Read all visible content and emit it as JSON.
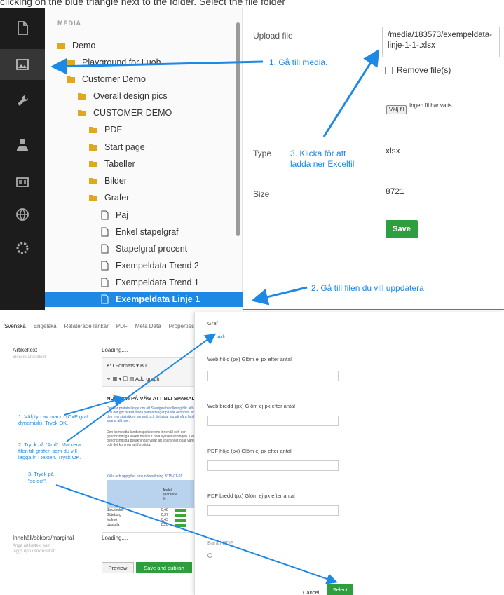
{
  "caption": "clicking on the blue triangle next to the folder. Select the file folder",
  "tree": {
    "header": "MEDIA",
    "items": [
      {
        "label": "Demo",
        "type": "folder"
      },
      {
        "label": "Playground for Luoh",
        "type": "folder"
      },
      {
        "label": "Customer Demo",
        "type": "folder"
      },
      {
        "label": "Overall design pics",
        "type": "folder"
      },
      {
        "label": "CUSTOMER DEMO",
        "type": "folder"
      },
      {
        "label": "PDF",
        "type": "folder"
      },
      {
        "label": "Start page",
        "type": "folder"
      },
      {
        "label": "Tabeller",
        "type": "folder"
      },
      {
        "label": "Bilder",
        "type": "folder"
      },
      {
        "label": "Grafer",
        "type": "folder"
      },
      {
        "label": "Paj",
        "type": "file"
      },
      {
        "label": "Enkel stapelgraf",
        "type": "file"
      },
      {
        "label": "Stapelgraf procent",
        "type": "file"
      },
      {
        "label": "Exempeldata Trend 2",
        "type": "file"
      },
      {
        "label": "Exempeldata Trend 1",
        "type": "file"
      },
      {
        "label": "Exempeldata Linje 1",
        "type": "file",
        "selected": true
      }
    ]
  },
  "form": {
    "upload_label": "Upload file",
    "upload_value": "/media/183573/exempeldata-linje-1-1-.xlsx",
    "remove_label": "Remove file(s)",
    "choose_button": "Välj fil",
    "no_file_text": "Ingen fil har valts",
    "type_label": "Type",
    "type_value": "xlsx",
    "size_label": "Size",
    "size_value": "8721",
    "save_button": "Save"
  },
  "editor": {
    "tabs": [
      "Svenska",
      "Engelska",
      "Relaterade länkar",
      "PDF",
      "Meta Data",
      "Properties"
    ],
    "article_label": "Artikeltext",
    "article_help": "Skriv in artikeltext",
    "loading": "Loading....",
    "toolbar_row1": "↶   I    Formats ▾    B    I",
    "toolbar_row2": "⚭  ▦ ▾  ☐   ▤   Add graph",
    "doc_heading": "NU ÄR VI PÅ VÄG ATT BLI SPARADE",
    "doc_text_blue": "Det har pratats länge om att Sveriges befolkning blir allt äldre och det gör också stora påfrestningar på vår ekonomi. Nu har den nya statistiken kommit och det visar sig att våra hushåll sparar allt mer.",
    "doc_text_grey": "Den kompletta landsinspektionens innehåll och den genomsnittliga vilken nivå hur hela sysselsättningen. Den genomsnittliga beräkningar visar att sparandet ökar varje år och det kommer att fortsätta.",
    "table_caption": "Källa och uppgifter om undersökning 2015-01-01",
    "table_header": "Andel sparande %",
    "table_rows": [
      {
        "label": "Stockholm",
        "value": "0,48"
      },
      {
        "label": "Göteborg",
        "value": "0,37"
      },
      {
        "label": "Malmö",
        "value": "0,43"
      },
      {
        "label": "Uppsala",
        "value": "0,28"
      }
    ],
    "search_label": "Innehåll/sökord/marginal",
    "search_help": "Ange artikeltext som läggs upp i sökresultat",
    "loading2": "Loading....",
    "preview_button": "Preview",
    "publish_button": "Save and publish"
  },
  "modal": {
    "title": "Graf",
    "add_label": "Add",
    "field1_label": "Web höjd (px) Glöm ej px efter antal",
    "field2_label": "Web bredd (px) Glöm ej px efter antal",
    "field3_label": "PDF höjd (px) Glöm ej px efter antal",
    "field4_label": "PDF bredd (px) Glöm ej px efter antal",
    "pdf_label": "Bara i PDF",
    "cancel_button": "Cancel",
    "select_button": "Select"
  },
  "annotations": {
    "a1": "1. Gå till media.",
    "a2": "2. Gå till filen du vill uppdatera",
    "a3_line1": "3. Klicka för att",
    "a3_line2": "ladda ner Excelfil",
    "b1": "1. Välj typ av macro (OxP graf dynamisk). Tryck OK.",
    "b2": "2. Tryck på \"Add\". Markera filen till grafen som du vill lägga in i texten. Tryck OK.",
    "b3_line1": "3. Tryck på",
    "b3_line2": "\"select\"."
  },
  "colors": {
    "accent": "#1e88e5",
    "save_green": "#2e9e3e",
    "sidebar_dark": "#1c1c1c"
  }
}
